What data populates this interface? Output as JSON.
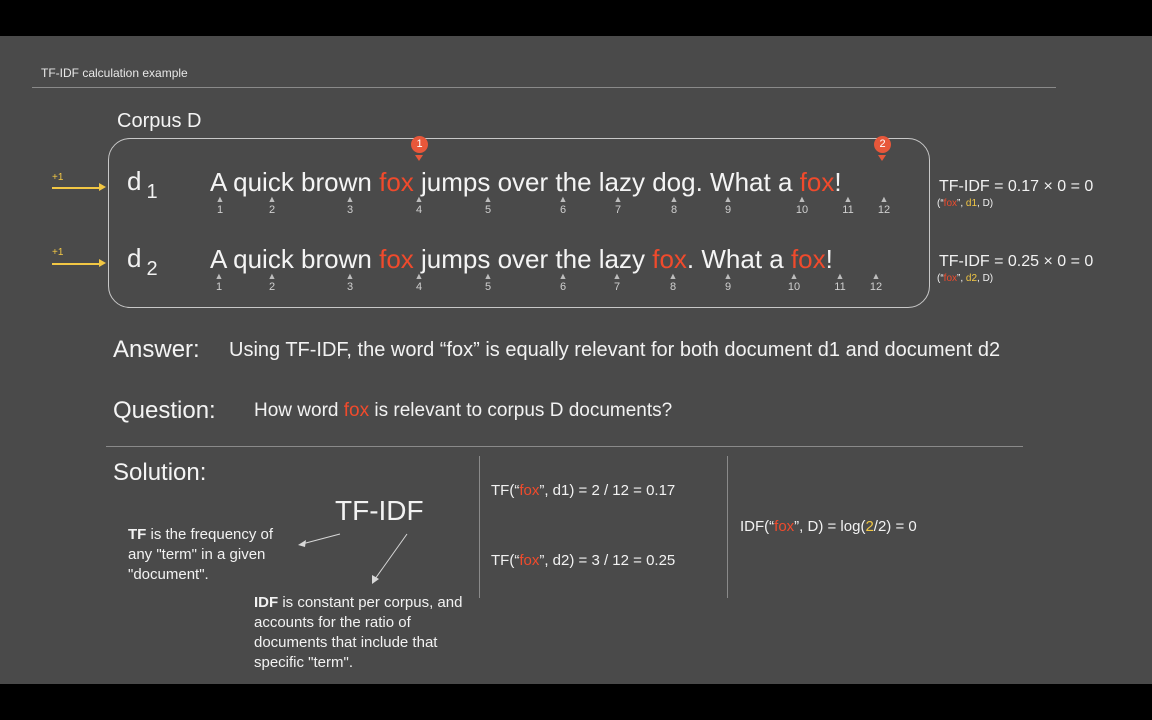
{
  "header": {
    "title": "TF-IDF calculation example"
  },
  "corpus_label": "Corpus D",
  "docs": [
    {
      "name": "d",
      "sub": "1",
      "plus": "+1",
      "tokens": [
        {
          "t": "A quick brown ",
          "hl": false
        },
        {
          "t": "fox",
          "hl": true
        },
        {
          "t": " jumps over the lazy dog. What a ",
          "hl": false
        },
        {
          "t": "fox",
          "hl": true
        },
        {
          "t": "!",
          "hl": false
        }
      ],
      "numbers": [
        "1",
        "2",
        "3",
        "4",
        "5",
        "6",
        "7",
        "8",
        "9",
        "10",
        "11",
        "12"
      ],
      "result": "TF-IDF = 0.17 × 0 = 0",
      "result_sub": {
        "open": "(“",
        "term": "fox",
        "mid": "”, ",
        "doc": "d1",
        "end": ", D)"
      }
    },
    {
      "name": "d",
      "sub": "2",
      "plus": "+1",
      "tokens": [
        {
          "t": "A quick brown ",
          "hl": false
        },
        {
          "t": "fox",
          "hl": true
        },
        {
          "t": " jumps over the lazy ",
          "hl": false
        },
        {
          "t": "fox",
          "hl": true
        },
        {
          "t": ". What a ",
          "hl": false
        },
        {
          "t": "fox",
          "hl": true
        },
        {
          "t": "!",
          "hl": false
        }
      ],
      "numbers": [
        "1",
        "2",
        "3",
        "4",
        "5",
        "6",
        "7",
        "8",
        "9",
        "10",
        "11",
        "12"
      ],
      "result": "TF-IDF = 0.25 × 0 = 0",
      "result_sub": {
        "open": "(“",
        "term": "fox",
        "mid": "”, ",
        "doc": "d2",
        "end": ", D)"
      }
    }
  ],
  "badges": [
    "1",
    "2"
  ],
  "answer": {
    "label": "Answer:",
    "text": "Using TF-IDF, the word “fox” is equally relevant for both document d1 and document d2"
  },
  "question": {
    "label": "Question:",
    "pre": "How word ",
    "term": "fox",
    "post": " is relevant to corpus D documents?"
  },
  "solution": {
    "label": "Solution:",
    "tfidf": "TF-IDF",
    "tf_bold": "TF",
    "tf_note": " is the frequency of any \"term\" in a given \"document\".",
    "idf_bold": "IDF",
    "idf_note": " is constant per corpus, and accounts for the ratio of documents that include that specific \"term\".",
    "tf1": {
      "pre": "TF(“",
      "term": "fox",
      "post": "”, d1) = 2 / 12 = 0.17"
    },
    "tf2": {
      "pre": "TF(“",
      "term": "fox",
      "post": "”, d2) = 3 / 12 = 0.25"
    },
    "idf": {
      "pre": "IDF(“",
      "term": "fox",
      "mid": "”, D) =  log(",
      "num": "2",
      "post": "/2) = 0"
    }
  },
  "colors": {
    "highlight": "#f04a2c",
    "accent": "#f2c744",
    "background": "#4a4a4a"
  }
}
